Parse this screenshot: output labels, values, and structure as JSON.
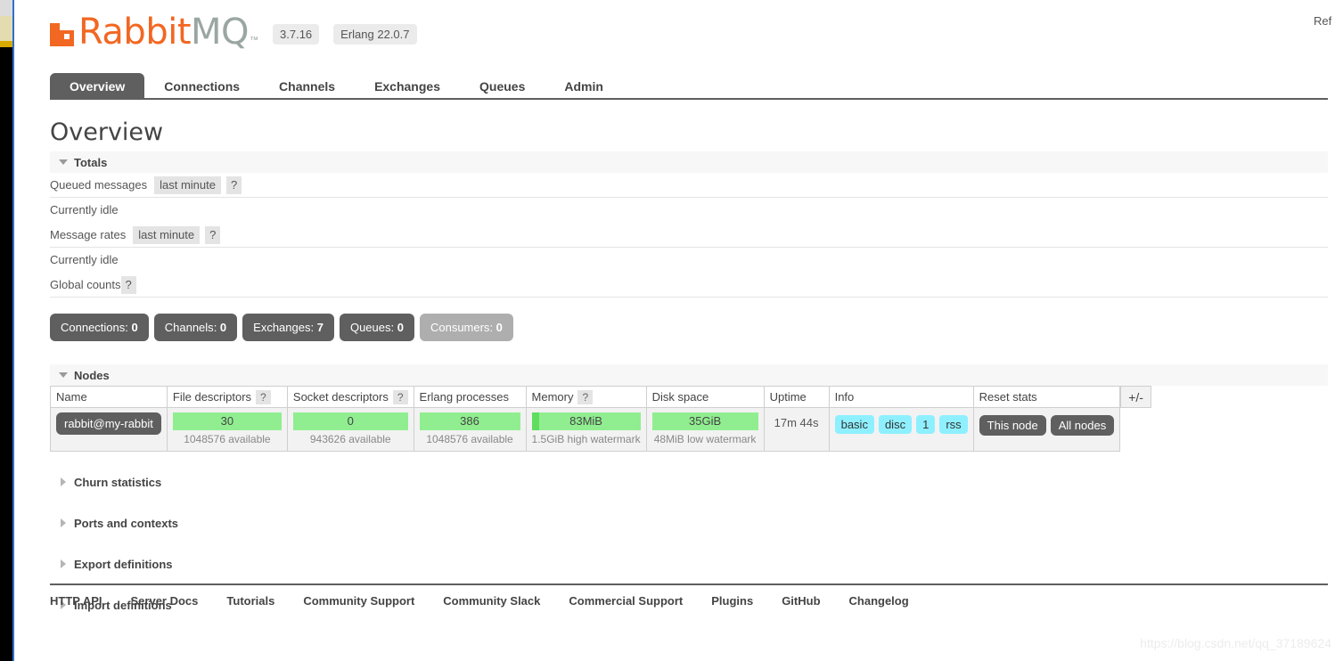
{
  "browser": {
    "watermark": "https://blog.csdn.net/qq_37189624"
  },
  "header": {
    "logo_primary": "Rabbit",
    "logo_secondary": "MQ",
    "logo_tm": "™",
    "version": "3.7.16",
    "erlang_version": "Erlang 22.0.7",
    "refresh_label": "Ref"
  },
  "nav": {
    "tabs": [
      {
        "label": "Overview",
        "active": true
      },
      {
        "label": "Connections",
        "active": false
      },
      {
        "label": "Channels",
        "active": false
      },
      {
        "label": "Exchanges",
        "active": false
      },
      {
        "label": "Queues",
        "active": false
      },
      {
        "label": "Admin",
        "active": false
      }
    ]
  },
  "main": {
    "page_title": "Overview",
    "totals": {
      "section_label": "Totals",
      "queued_messages_label": "Queued messages",
      "queued_messages_period": "last minute",
      "queued_messages_help": "?",
      "queued_messages_status": "Currently idle",
      "message_rates_label": "Message rates",
      "message_rates_period": "last minute",
      "message_rates_help": "?",
      "message_rates_status": "Currently idle",
      "global_counts_label": "Global counts",
      "global_counts_help": "?"
    },
    "global_counts": [
      {
        "name": "Connections",
        "value": "0",
        "disabled": false
      },
      {
        "name": "Channels",
        "value": "0",
        "disabled": false
      },
      {
        "name": "Exchanges",
        "value": "7",
        "disabled": false
      },
      {
        "name": "Queues",
        "value": "0",
        "disabled": false
      },
      {
        "name": "Consumers",
        "value": "0",
        "disabled": true
      }
    ],
    "nodes": {
      "section_label": "Nodes",
      "columns": {
        "name": "Name",
        "file_descriptors": "File descriptors",
        "file_descriptors_help": "?",
        "socket_descriptors": "Socket descriptors",
        "socket_descriptors_help": "?",
        "erlang_processes": "Erlang processes",
        "memory": "Memory",
        "memory_help": "?",
        "disk_space": "Disk space",
        "uptime": "Uptime",
        "info": "Info",
        "reset_stats": "Reset stats"
      },
      "plus_minus": "+/-",
      "row": {
        "node_name": "rabbit@my-rabbit",
        "file_descriptors_value": "30",
        "file_descriptors_sub": "1048576 available",
        "socket_descriptors_value": "0",
        "socket_descriptors_sub": "943626 available",
        "erlang_processes_value": "386",
        "erlang_processes_sub": "1048576 available",
        "memory_value": "83MiB",
        "memory_sub": "1.5GiB high watermark",
        "disk_space_value": "35GiB",
        "disk_space_sub": "48MiB low watermark",
        "uptime_value": "17m 44s",
        "info_badges": [
          "basic",
          "disc",
          "1",
          "rss"
        ],
        "reset_buttons": [
          "This node",
          "All nodes"
        ]
      }
    },
    "collapsed_sections": [
      {
        "label": "Churn statistics"
      },
      {
        "label": "Ports and contexts"
      },
      {
        "label": "Export definitions"
      },
      {
        "label": "Import definitions"
      }
    ]
  },
  "footer": {
    "links": [
      "HTTP API",
      "Server Docs",
      "Tutorials",
      "Community Support",
      "Community Slack",
      "Commercial Support",
      "Plugins",
      "GitHub",
      "Changelog"
    ]
  }
}
